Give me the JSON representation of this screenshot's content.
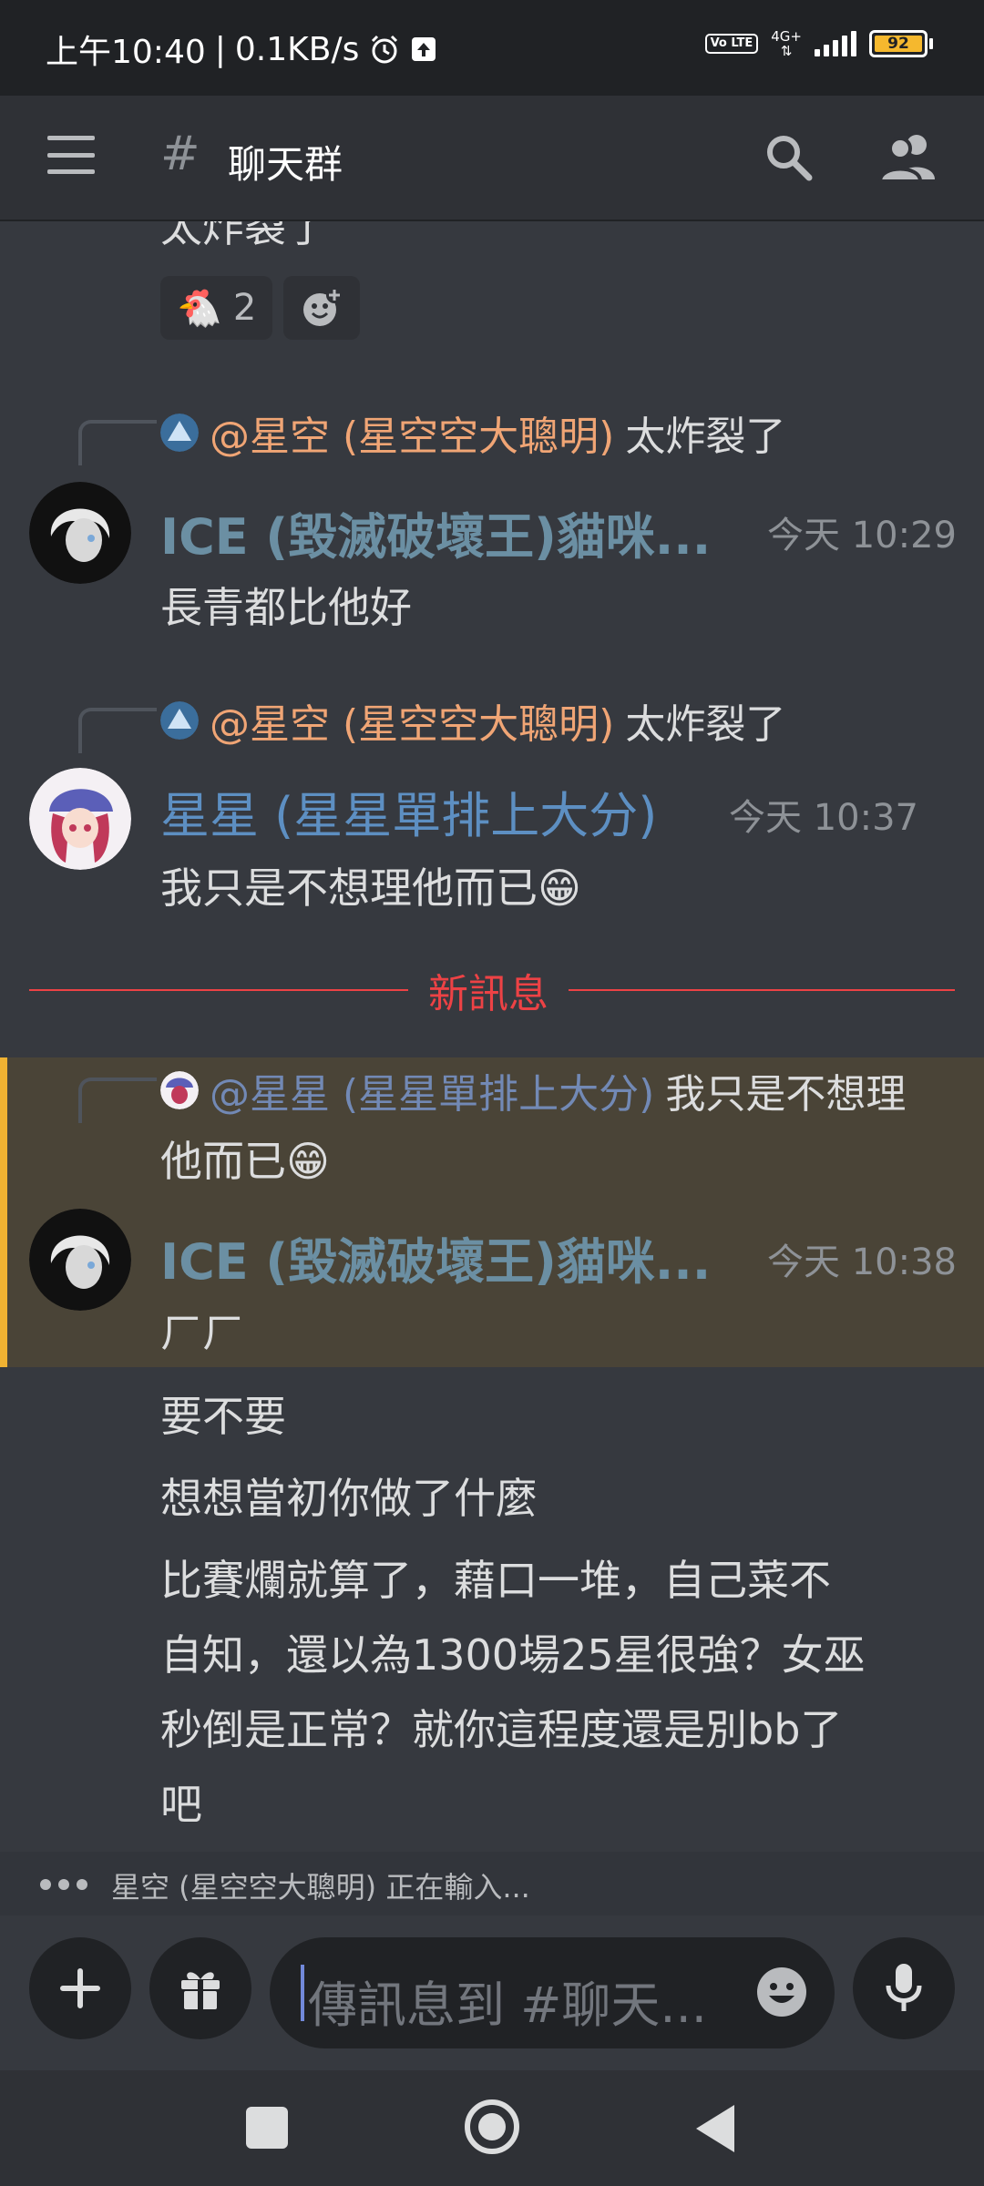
{
  "status_bar": {
    "time": "上午10:40",
    "net_speed": "0.1KB/s",
    "volte": "Vo LTE",
    "network": "4G+",
    "battery": "92"
  },
  "header": {
    "hash": "#",
    "channel": "聊天群"
  },
  "messages": {
    "cut_text": "太炸裂了",
    "reaction": {
      "emoji": "🐔",
      "count": "2"
    },
    "reply1": {
      "mention": "@星空 (星空空大聰明)",
      "text": "太炸裂了"
    },
    "msg1": {
      "author": "ICE (毀滅破壞王)貓咪...",
      "time": "今天 10:29",
      "text": "長青都比他好"
    },
    "reply2": {
      "mention": "@星空 (星空空大聰明)",
      "text": "太炸裂了"
    },
    "msg2": {
      "author": "星星 (星星單排上大分)",
      "time": "今天 10:37",
      "text": "我只是不想理他而已😁"
    },
    "divider": "新訊息",
    "reply3": {
      "mention": "@星星 (星星單排上大分)",
      "text": "我只是不想理",
      "text2": "他而已😁"
    },
    "msg3": {
      "author": "ICE (毀滅破壞王)貓咪...",
      "time": "今天 10:38",
      "lines": [
        "ㄏㄏ",
        "要不要",
        "想想當初你做了什麼"
      ],
      "para": [
        "比賽爛就算了，藉口一堆，自己菜不",
        "自知，還以為1300場25星很強？女巫",
        "秒倒是正常？就你這程度還是別bb了",
        "吧"
      ]
    }
  },
  "typing": "星空 (星空空大聰明) 正在輸入...",
  "composer": {
    "placeholder": "傳訊息到 #聊天..."
  },
  "colors": {
    "background": "#36393f",
    "header": "#2f3136",
    "mention_orange": "#f0a575",
    "new_divider": "#ed4245",
    "highlight_bar": "#f0b232"
  },
  "icons": [
    "menu-icon",
    "search-icon",
    "members-icon",
    "add-reaction-icon",
    "plus-icon",
    "gift-icon",
    "emoji-icon",
    "microphone-icon",
    "alarm-icon",
    "upload-icon"
  ]
}
